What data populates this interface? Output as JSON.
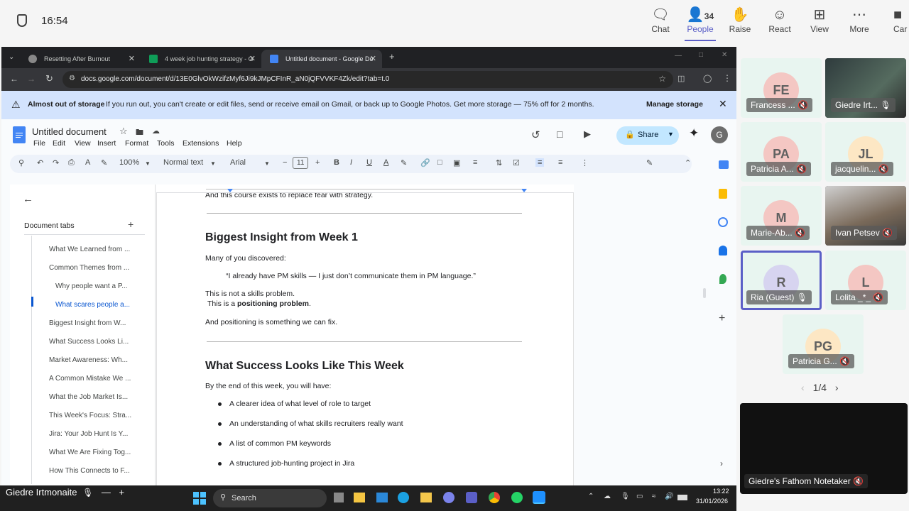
{
  "teams": {
    "time": "16:54",
    "buttons": [
      {
        "label": "Chat",
        "icon": "chat-icon"
      },
      {
        "label": "People",
        "icon": "people-icon",
        "count": "34"
      },
      {
        "label": "Raise",
        "icon": "hand-icon"
      },
      {
        "label": "React",
        "icon": "smile-icon"
      },
      {
        "label": "View",
        "icon": "grid-icon"
      },
      {
        "label": "More",
        "icon": "more-icon"
      },
      {
        "label": "Car",
        "icon": "camera-icon"
      }
    ],
    "participants": [
      {
        "initials": "FE",
        "name": "Francess ...",
        "color": "#f4c7c3"
      },
      {
        "initials": "",
        "name": "Giedre Irt...",
        "color": "#3a3a3a"
      },
      {
        "initials": "PA",
        "name": "Patricia A...",
        "color": "#f4c7c3"
      },
      {
        "initials": "JL",
        "name": "jacquelin...",
        "color": "#fde7c4"
      },
      {
        "initials": "M",
        "name": "Marie-Ab...",
        "color": "#f4c7c3"
      },
      {
        "initials": "",
        "name": "Ivan Petsev",
        "color": "#3a3a3a"
      },
      {
        "initials": "R",
        "name": "Ria (Guest)",
        "color": "#d7d4f0"
      },
      {
        "initials": "L",
        "name": "Lolita _*_",
        "color": "#f4c7c3"
      },
      {
        "initials": "PG",
        "name": "Patricia G...",
        "color": "#fde7c4"
      }
    ],
    "pager": "1/4",
    "notetaker": "Giedre's Fathom Notetaker",
    "presenter": "Giedre Irtmonaite"
  },
  "browser": {
    "tabs": [
      {
        "title": "Resetting After Burnout"
      },
      {
        "title": "4 week job hunting strategy - G"
      },
      {
        "title": "Untitled document - Google Do"
      }
    ],
    "url": "docs.google.com/document/d/13E0GlvOkWzifzMyf6Ji9kJMpCFInR_aN0jQFVVKF4Zk/edit?tab=t.0"
  },
  "storage_banner": {
    "title": "Almost out of storage",
    "text": "If you run out, you can't create or edit files, send or receive email on Gmail, or back up to Google Photos. Get more storage — 75% off for 2 months.",
    "action": "Manage storage"
  },
  "docs": {
    "title": "Untitled document",
    "menus": [
      "File",
      "Edit",
      "View",
      "Insert",
      "Format",
      "Tools",
      "Extensions",
      "Help"
    ],
    "share": "Share",
    "avatar": "G",
    "toolbar": {
      "zoom": "100%",
      "style": "Normal text",
      "font": "Arial",
      "size": "11"
    },
    "tabs_header": "Document tabs",
    "outline": [
      {
        "label": "What We Learned from ...",
        "level": 1
      },
      {
        "label": "Common Themes from ...",
        "level": 1
      },
      {
        "label": "Why people want a P...",
        "level": 2
      },
      {
        "label": "What scares people a...",
        "level": 2,
        "selected": true
      },
      {
        "label": "Biggest Insight from W...",
        "level": 1
      },
      {
        "label": "What Success Looks Li...",
        "level": 1
      },
      {
        "label": "Market Awareness: Wh...",
        "level": 1
      },
      {
        "label": "A Common Mistake We ...",
        "level": 1
      },
      {
        "label": "What the Job Market Is...",
        "level": 1
      },
      {
        "label": "This Week's Focus: Stra...",
        "level": 1
      },
      {
        "label": "Jira: Your Job Hunt Is Y...",
        "level": 1
      },
      {
        "label": "What We Are Fixing Tog...",
        "level": 1
      },
      {
        "label": "How This Connects to F...",
        "level": 1
      }
    ],
    "content": {
      "intro_line": "And this course exists to replace fear with strategy.",
      "h_insight": "Biggest Insight from Week 1",
      "p_discovered": "Many of you discovered:",
      "quote": "“I already have PM skills — I just don’t communicate them in PM language.”",
      "p_not_skills": "This is not a skills problem.",
      "p_positioning_pre": "This is a ",
      "p_positioning_bold": "positioning problem",
      "p_positioning_post": ".",
      "p_fix": "And positioning is something we can fix.",
      "h_success": "What Success Looks Like This Week",
      "p_end_week": "By the end of this week, you will have:",
      "bullets": [
        "A clearer idea of what level of role to target",
        "An understanding of what skills recruiters really want",
        "A list of common PM keywords",
        "A structured job-hunting project in Jira"
      ]
    }
  },
  "taskbar": {
    "search": "Search",
    "time": "13:22",
    "date": "31/01/2026"
  }
}
